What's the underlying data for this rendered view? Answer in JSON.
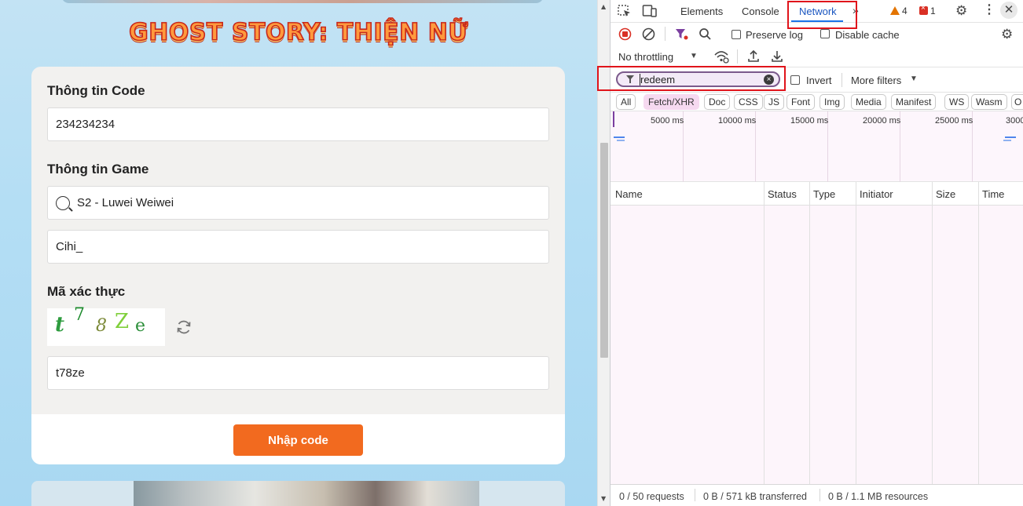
{
  "page": {
    "game_title": "GHOST STORY: THIỆN NỮ",
    "code_section": {
      "title": "Thông tin Code",
      "value": "234234234"
    },
    "game_section": {
      "title": "Thông tin Game",
      "server_value": "S2 - Luwei Weiwei",
      "character_value": "Cihi_"
    },
    "captcha_section": {
      "title": "Mã xác thực",
      "captcha_chars": [
        "t",
        "7",
        "8",
        "Z",
        "e"
      ],
      "captcha_colors": [
        "#2e9c3f",
        "#1c8a2c",
        "#7c8a3a",
        "#7fcf3a",
        "#2c8f3a"
      ],
      "value": "t78ze"
    },
    "submit_label": "Nhập code",
    "accent_color": "#f26a1f"
  },
  "devtools": {
    "tabs": [
      "Elements",
      "Console",
      "Network"
    ],
    "active_tab": "Network",
    "warnings_count": "4",
    "errors_count": "1",
    "preserve_log_label": "Preserve log",
    "disable_cache_label": "Disable cache",
    "throttling_label": "No throttling",
    "filter_value": "redeem",
    "invert_label": "Invert",
    "more_filters_label": "More filters",
    "type_filters": [
      "All",
      "Fetch/XHR",
      "Doc",
      "CSS",
      "JS",
      "Font",
      "Img",
      "Media",
      "Manifest",
      "WS",
      "Wasm",
      "O"
    ],
    "active_type_filter": "Fetch/XHR",
    "timeline_labels": [
      "5000 ms",
      "10000 ms",
      "15000 ms",
      "20000 ms",
      "25000 ms",
      "3000"
    ],
    "columns": [
      "Name",
      "Status",
      "Type",
      "Initiator",
      "Size",
      "Time"
    ],
    "status_bar": {
      "requests": "0 / 50 requests",
      "transferred": "0 B / 571 kB transferred",
      "resources": "0 B / 1.1 MB resources"
    }
  }
}
